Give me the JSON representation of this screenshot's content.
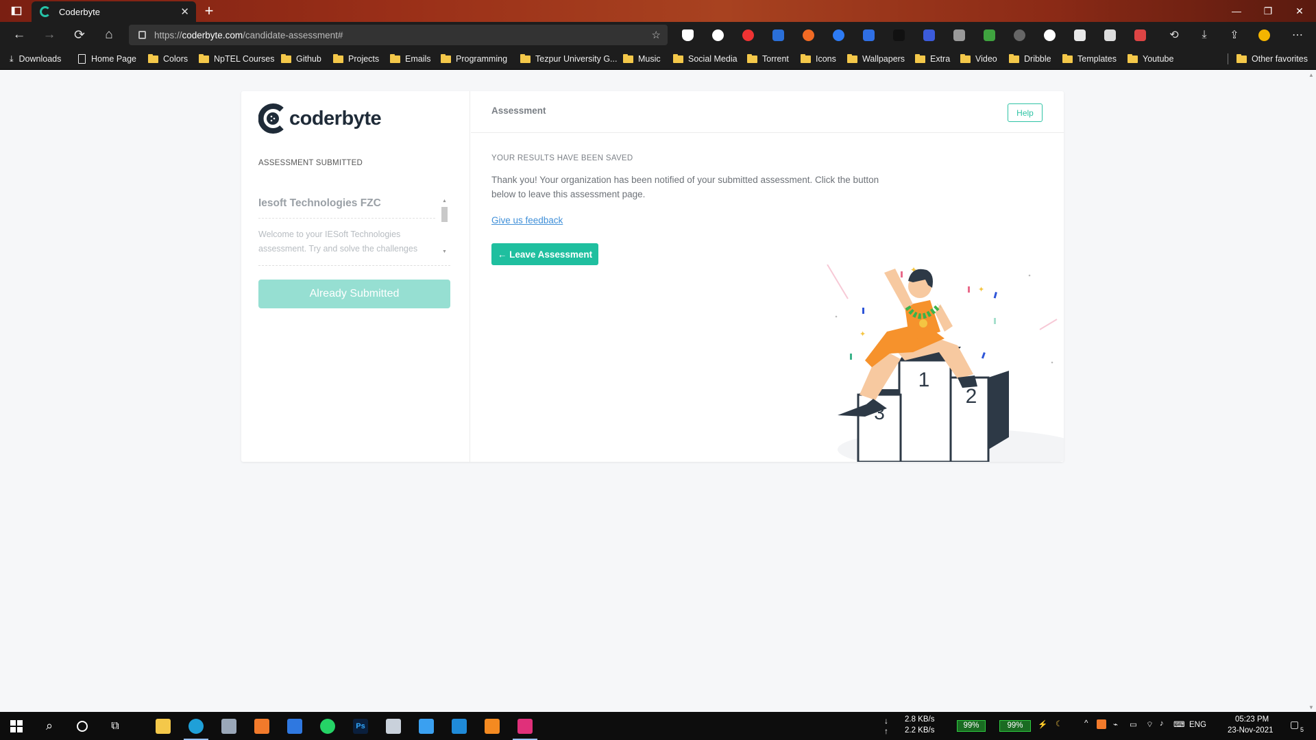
{
  "browser": {
    "tab_title": "Coderbyte",
    "tab_close": "✕",
    "new_tab": "+",
    "address_scheme": "https://",
    "address_host": "coderbyte.com",
    "address_path": "/candidate-assessment#",
    "bookmarks": [
      {
        "label": "Downloads",
        "kind": "download"
      },
      {
        "label": "Home Page",
        "kind": "page"
      },
      {
        "label": "Colors",
        "kind": "folder"
      },
      {
        "label": "NpTEL Courses",
        "kind": "folder"
      },
      {
        "label": "Github",
        "kind": "folder"
      },
      {
        "label": "Projects",
        "kind": "folder"
      },
      {
        "label": "Emails",
        "kind": "folder"
      },
      {
        "label": "Programming",
        "kind": "folder"
      },
      {
        "label": "Tezpur University G...",
        "kind": "folder"
      },
      {
        "label": "Music",
        "kind": "folder"
      },
      {
        "label": "Social Media",
        "kind": "folder"
      },
      {
        "label": "Torrent",
        "kind": "folder"
      },
      {
        "label": "Icons",
        "kind": "folder"
      },
      {
        "label": "Wallpapers",
        "kind": "folder"
      },
      {
        "label": "Extra",
        "kind": "folder"
      },
      {
        "label": "Video",
        "kind": "folder"
      },
      {
        "label": "Dribble",
        "kind": "folder"
      },
      {
        "label": "Templates",
        "kind": "folder"
      },
      {
        "label": "Youtube",
        "kind": "folder"
      }
    ],
    "other_favorites": "Other favorites"
  },
  "sidebar": {
    "logo_text": "coderbyte",
    "status_heading": "ASSESSMENT SUBMITTED",
    "org_name": "Iesoft Technologies FZC",
    "org_description": "Welcome to your IESoft Technologies assessment. Try and solve the challenges",
    "submitted_button": "Already Submitted"
  },
  "main": {
    "header_title": "Assessment",
    "help_button": "Help",
    "saved_heading": "YOUR RESULTS HAVE BEEN SAVED",
    "thanks_text": "Thank you! Your organization has been notified of your submitted assessment. Click the button below to leave this assessment page.",
    "feedback_link": "Give us feedback",
    "leave_button": "← Leave Assessment",
    "podium": {
      "first": "1",
      "second": "2",
      "third": "3"
    }
  },
  "taskbar": {
    "net_down": "2.8 KB/s",
    "net_up": "2.2 KB/s",
    "battery_1": "99%",
    "battery_2": "99%",
    "language": "ENG",
    "time": "05:23 PM",
    "date": "23-Nov-2021",
    "notifications": "5"
  },
  "colors": {
    "brand_teal": "#1fbf9f",
    "disabled_teal": "#96dfd2",
    "link_blue": "#3f8fd8",
    "logo_dark": "#1f2b38"
  }
}
